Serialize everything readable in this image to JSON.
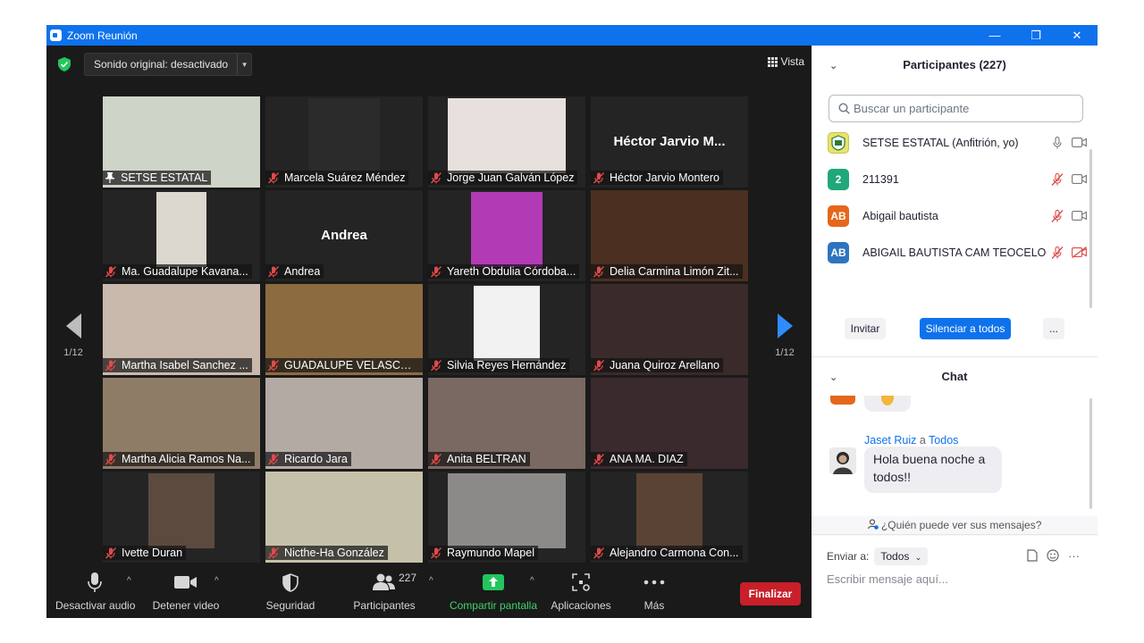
{
  "window": {
    "title": "Zoom Reunión",
    "minimize": "—",
    "restore": "❐",
    "close": "✕"
  },
  "top": {
    "sound_label": "Sonido original: desactivado",
    "view_label": "Vista"
  },
  "pagination": {
    "left_page": "1/12",
    "right_page": "1/12"
  },
  "tiles": [
    {
      "name": "SETSE ESTATAL",
      "type": "full",
      "color": "#cfd4c9",
      "pinned": true,
      "active": true
    },
    {
      "name": "Marcela Suárez Méndez",
      "type": "thumb",
      "width": 80,
      "color": "#2b2b2b"
    },
    {
      "name": "Jorge Juan Galván López",
      "type": "thumb",
      "width": 132,
      "color": "#e7e0dc"
    },
    {
      "name": "Héctor Jarvio Montero",
      "type": "text",
      "big": "Héctor Jarvio M..."
    },
    {
      "name": "Ma. Guadalupe Kavana...",
      "type": "thumb",
      "width": 56,
      "color": "#dcd8cf"
    },
    {
      "name": "Andrea",
      "type": "text",
      "big": "Andrea"
    },
    {
      "name": "Yareth Obdulia Córdoba...",
      "type": "thumb",
      "width": 80,
      "color": "#b23bb5"
    },
    {
      "name": "Delia Carmina Limón Zit...",
      "type": "full",
      "color": "#4b2f20"
    },
    {
      "name": "Martha Isabel Sanchez ...",
      "type": "full",
      "color": "#c9b9ac"
    },
    {
      "name": "GUADALUPE VELASCO A...",
      "type": "full",
      "color": "#8d6b40"
    },
    {
      "name": "Silvia Reyes Hernández",
      "type": "thumb",
      "width": 74,
      "color": "#f2f2f2"
    },
    {
      "name": "Juana Quiroz Arellano",
      "type": "full",
      "color": "#3b2a2a"
    },
    {
      "name": "Martha Alicia Ramos Na...",
      "type": "full",
      "color": "#8f7c67"
    },
    {
      "name": "Ricardo Jara",
      "type": "full",
      "color": "#b4aaa4"
    },
    {
      "name": "Anita BELTRAN",
      "type": "full",
      "color": "#7a6862"
    },
    {
      "name": "ANA MA. DIAZ",
      "type": "full",
      "color": "#3a2a2e"
    },
    {
      "name": "Ivette Duran",
      "type": "thumb",
      "width": 74,
      "color": "#5d4a3e"
    },
    {
      "name": "Nicthe-Ha González",
      "type": "full",
      "color": "#c5c1a9"
    },
    {
      "name": "Raymundo Mapel",
      "type": "thumb",
      "width": 132,
      "color": "#8c8a88"
    },
    {
      "name": "Alejandro Carmona Con...",
      "type": "thumb",
      "width": 74,
      "color": "#5a4335"
    }
  ],
  "toolbar": {
    "mute": "Desactivar audio",
    "video": "Detener video",
    "security": "Seguridad",
    "participants": "Participantes",
    "participants_count": "227",
    "share": "Compartir pantalla",
    "apps": "Aplicaciones",
    "more": "Más",
    "end": "Finalizar"
  },
  "participants_panel": {
    "title": "Participantes (227)",
    "search_placeholder": "Buscar un participante",
    "items": [
      {
        "name": "SETSE ESTATAL (Anfitrión, yo)",
        "avatar": "",
        "avatar_color": "#e8e36a",
        "muted": false,
        "video_off": false
      },
      {
        "name": "211391",
        "avatar": "2",
        "avatar_color": "#20a87a",
        "muted": true,
        "video_off": false
      },
      {
        "name": "Abigail bautista",
        "avatar": "AB",
        "avatar_color": "#e5671c",
        "muted": true,
        "video_off": false
      },
      {
        "name": "ABIGAIL BAUTISTA CAM TEOCELO",
        "avatar": "AB",
        "avatar_color": "#2f74c0",
        "muted": true,
        "video_off": true
      }
    ],
    "invite": "Invitar",
    "mute_all": "Silenciar a todos",
    "more": "..."
  },
  "chat_panel": {
    "title": "Chat",
    "sender": "Jaset Ruiz",
    "to_word": "a",
    "recipient": "Todos",
    "message": "Hola buena noche a todos!!",
    "who_can_see": "¿Quién puede ver sus mensajes?",
    "send_to_label": "Enviar a:",
    "send_to_value": "Todos",
    "input_placeholder": "Escribir mensaje aquí..."
  }
}
